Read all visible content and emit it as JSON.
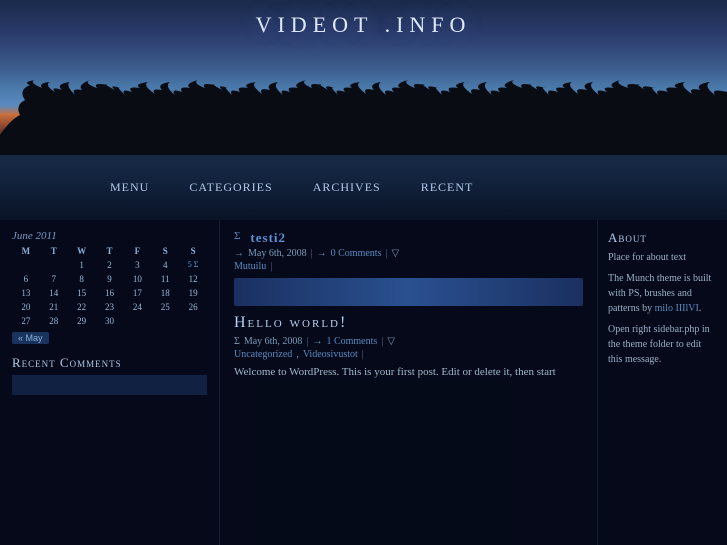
{
  "site": {
    "title": "VIDEOT .INFO"
  },
  "nav": {
    "items": [
      "MENU",
      "CATEGORIES",
      "ARCHIVES",
      "RECENT"
    ]
  },
  "calendar": {
    "month_year": "June 2011",
    "day_headers": [
      "M",
      "T",
      "W",
      "T",
      "F",
      "S",
      "S"
    ],
    "rows": [
      [
        "",
        "",
        "1",
        "2",
        "3",
        "4",
        "5"
      ],
      [
        "6",
        "7",
        "8",
        "9",
        "10",
        "11",
        "12"
      ],
      [
        "13",
        "14",
        "15",
        "16",
        "17",
        "18",
        "19"
      ],
      [
        "20",
        "21",
        "22",
        "23",
        "24",
        "25",
        "26"
      ],
      [
        "27",
        "28",
        "29",
        "30",
        "",
        "",
        ""
      ]
    ],
    "nav_label": "« May"
  },
  "sidebar_left": {
    "recent_comments_title": "Recent Comments",
    "recent_comments_content": ""
  },
  "post1": {
    "arrow": "Σ",
    "title": "testi2",
    "date": "May 6th, 2008",
    "arrow2": "→",
    "comments": "0 Comments",
    "pipe1": "|",
    "nabla": "▽",
    "category": "Mutuilu",
    "pipe2": "|"
  },
  "post2": {
    "arrow": "Σ",
    "date": "May 6th, 2008",
    "arrow2": "→",
    "comments": "1 Comments",
    "pipe1": "|",
    "nabla": "▽",
    "category1": "Uncategorized",
    "comma": ",",
    "category2": "Videosivustot",
    "pipe2": "|",
    "title": "Hello world!",
    "body": "Welcome to WordPress. This is your first post. Edit or delete it, then start"
  },
  "about": {
    "title": "About",
    "line1": "Place  for about text",
    "body1": "The  Munch theme is built with    PS, brushes and patterns by",
    "link_text": "milo IIIlVI",
    "link_url": "#",
    "body2": "Open  right sidebar.php in the theme folder to edit this message."
  }
}
